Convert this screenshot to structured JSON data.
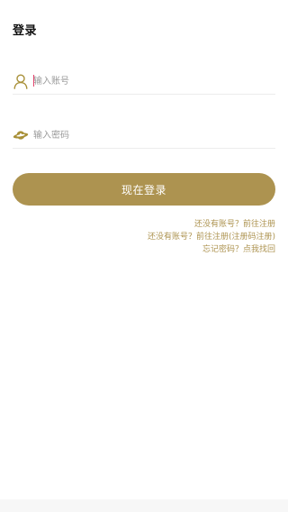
{
  "header": {
    "title": "登录"
  },
  "form": {
    "account": {
      "placeholder": "输入账号",
      "icon": "user-icon",
      "value": ""
    },
    "password": {
      "placeholder": "输入密码",
      "icon": "planet-icon",
      "value": ""
    },
    "submit_label": "现在登录"
  },
  "links": {
    "register": "还没有账号？前往注册",
    "register_code": "还没有账号？前往注册(注册码注册)",
    "forgot": "忘记密码？点我找回"
  },
  "colors": {
    "accent": "#ad9350",
    "icon_gold": "#a89038",
    "caret": "#e2406a"
  }
}
